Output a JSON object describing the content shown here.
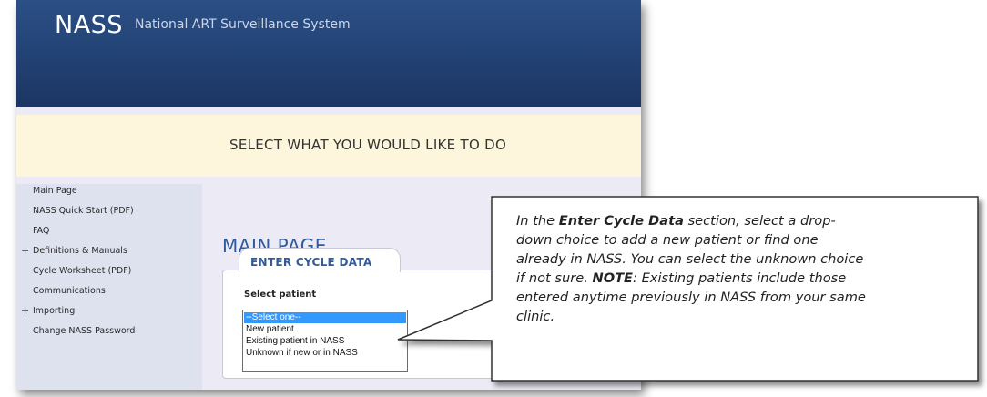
{
  "app": {
    "logo": "NASS",
    "subtitle": "National ART Surveillance System"
  },
  "prompt": "SELECT WHAT YOU WOULD LIKE TO DO",
  "sidebar": {
    "items": [
      {
        "label": "Main Page",
        "expandable": false
      },
      {
        "label": "NASS Quick Start (PDF)",
        "expandable": false
      },
      {
        "label": "FAQ",
        "expandable": false
      },
      {
        "label": "Definitions & Manuals",
        "expandable": true
      },
      {
        "label": "Cycle Worksheet (PDF)",
        "expandable": false
      },
      {
        "label": "Communications",
        "expandable": false
      },
      {
        "label": "Importing",
        "expandable": true
      },
      {
        "label": "Change NASS Password",
        "expandable": false
      }
    ],
    "plus_symbol": "+"
  },
  "main": {
    "title": "MAIN PAGE",
    "tab_label": "ENTER CYCLE DATA",
    "field_label": "Select patient",
    "patient_options": [
      "--Select one--",
      "New patient",
      "Existing patient in NASS",
      "Unknown if new or in NASS"
    ],
    "selected_option": "--Select one--"
  },
  "callout": {
    "part1": "In the ",
    "bold1": "Enter Cycle Data",
    "part2": " section, select a drop-down choice to add a new patient or find one already in NASS. You can select the unknown choice if not sure. ",
    "bold2": "NOTE",
    "part3": ": Existing patients include those entered anytime previously in NASS from your same clinic."
  },
  "colors": {
    "header_bg": "#234476",
    "accent_title": "#2f5a9c",
    "prompt_band": "#fdf6dc",
    "sidebar_bg": "#dde2ee",
    "selected_option_bg": "#3399ff"
  }
}
